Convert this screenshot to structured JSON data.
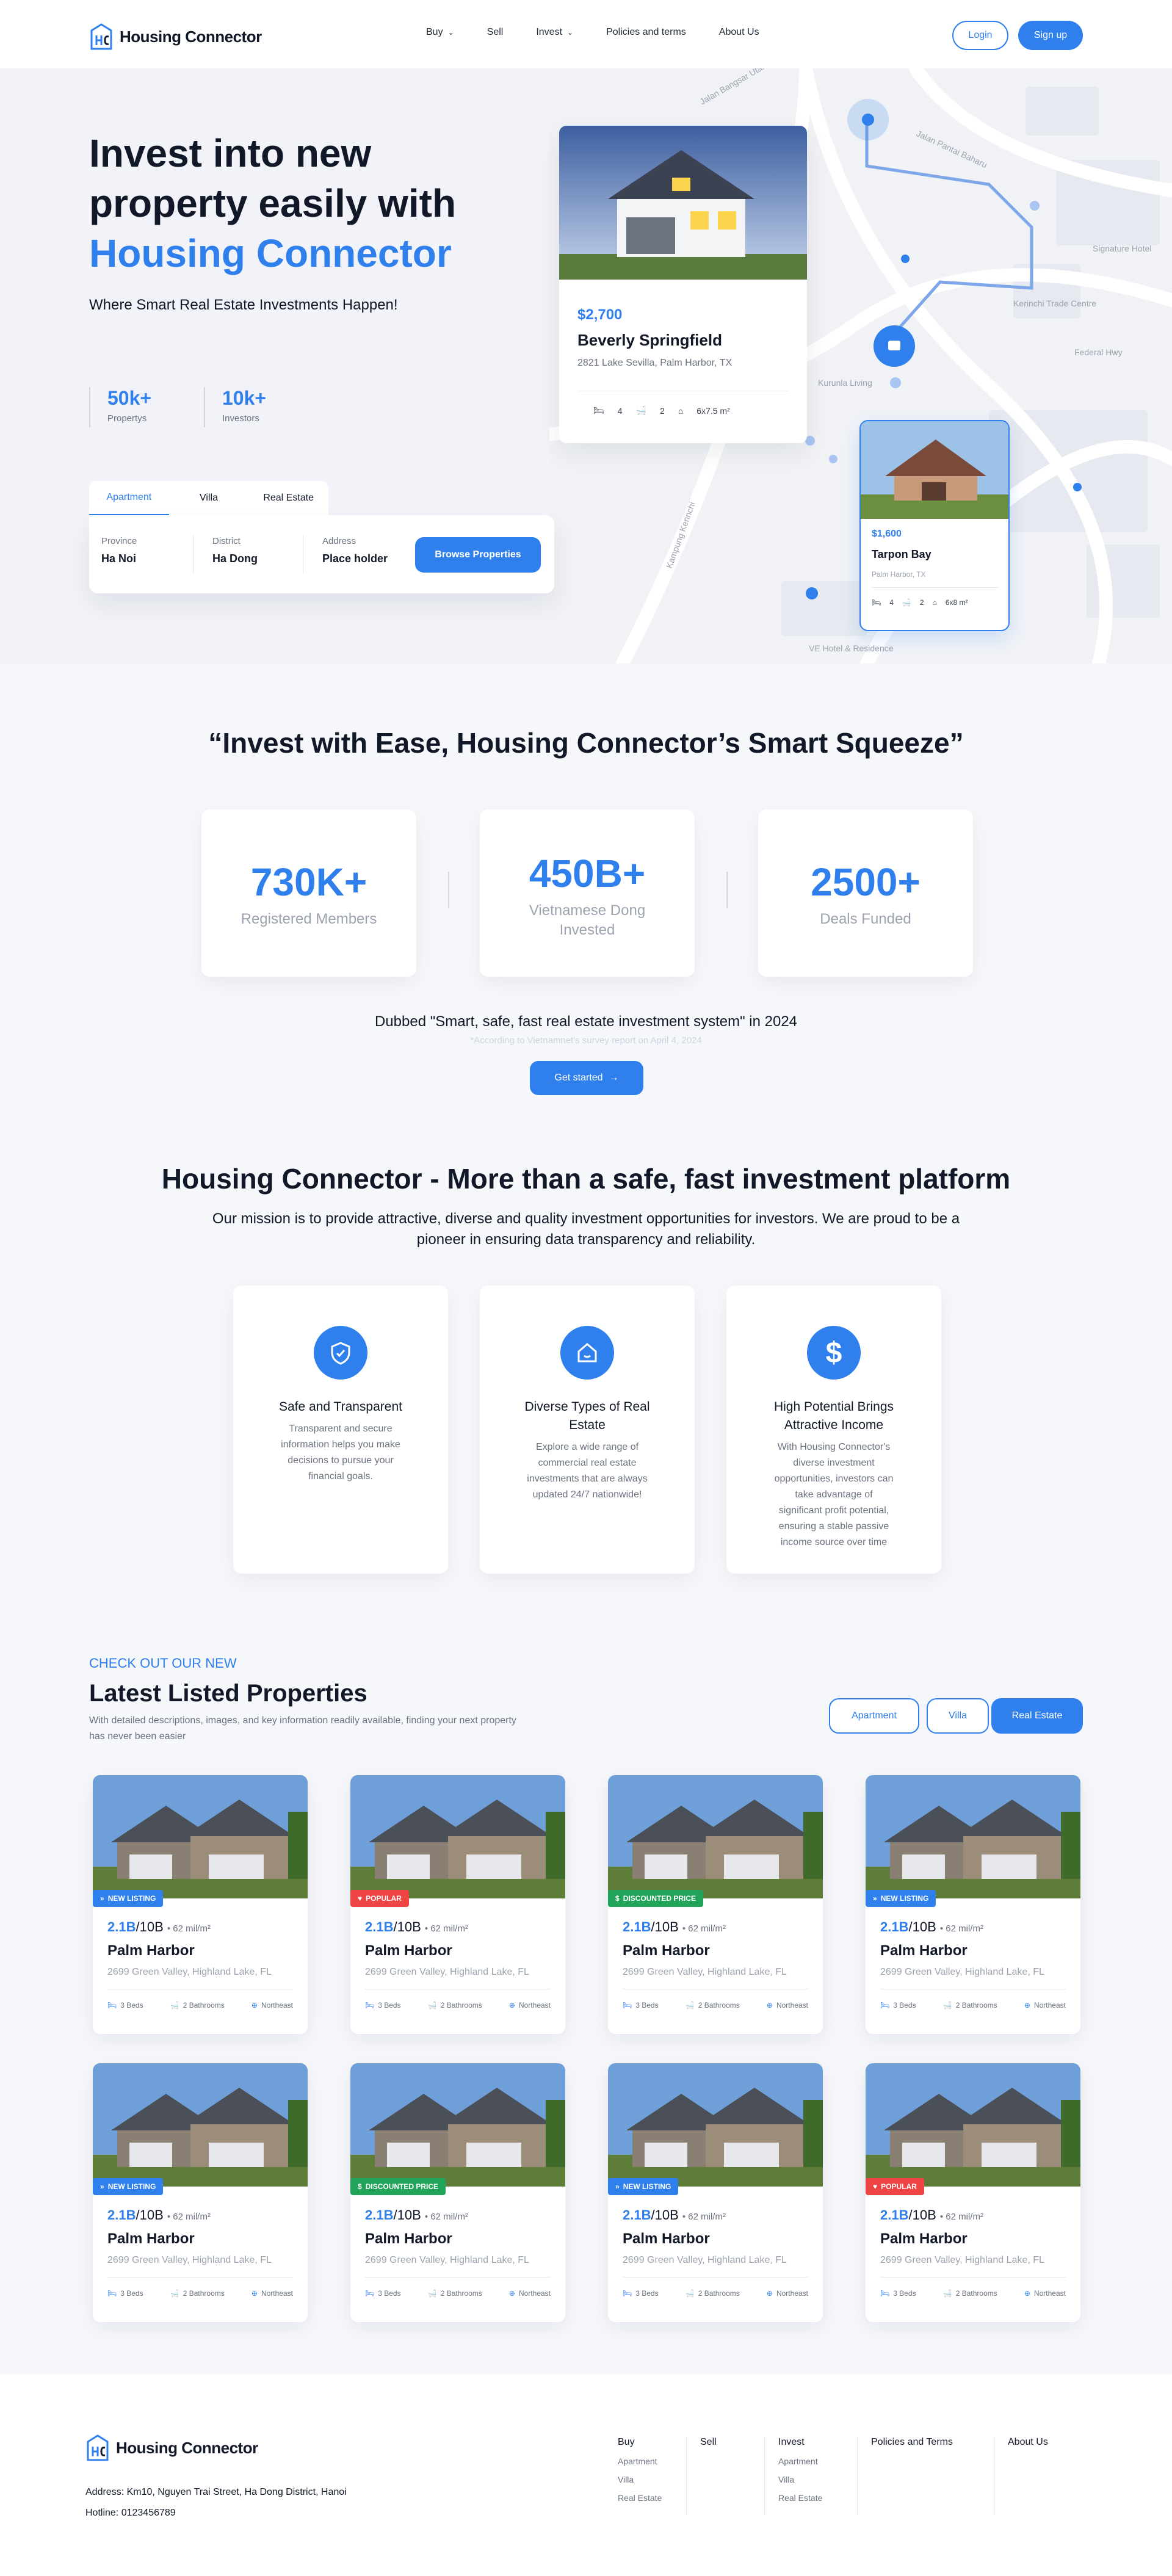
{
  "brand": {
    "name": "Housing Connector"
  },
  "nav": {
    "items": [
      "Buy",
      "Sell",
      "Invest",
      "Policies and terms",
      "About Us"
    ],
    "login": "Login",
    "signup": "Sign up"
  },
  "hero": {
    "title_line1": "Invest into new",
    "title_line2": "property easily with",
    "title_highlight": "Housing Connector",
    "subtitle": "Where Smart Real Estate Investments Happen!",
    "stats": [
      {
        "num": "50k+",
        "label": "Propertys"
      },
      {
        "num": "10k+",
        "label": "Investors"
      }
    ],
    "tabs": [
      "Apartment",
      "Villa",
      "Real Estate"
    ],
    "active_tab": "Apartment",
    "search": {
      "province_label": "Province",
      "province_value": "Ha Noi",
      "district_label": "District",
      "district_value": "Ha Dong",
      "address_label": "Address",
      "address_value": "Place holder",
      "button": "Browse Properties"
    },
    "featured": {
      "price": "$2,700",
      "name": "Beverly Springfield",
      "address": "2821 Lake Sevilla, Palm Harbor, TX",
      "beds": "4",
      "baths": "2",
      "area": "6x7.5 m²"
    },
    "small_card": {
      "price": "$1,600",
      "name": "Tarpon Bay",
      "address": "Palm Harbor, TX",
      "beds": "4",
      "baths": "2",
      "area": "6x8 m²"
    },
    "map_labels": [
      "Jalan Pantai Baharu",
      "Signature Hotel",
      "Federal Hwy",
      "Kurunla Living",
      "Kerinchi Trade Centre",
      "VE Hotel & Residence",
      "Jalan Bangsar Utama",
      "Kampung Kerinchi"
    ]
  },
  "stats_section": {
    "title": "“Invest with Ease, Housing Connector’s Smart Squeeze”",
    "items": [
      {
        "num": "730K+",
        "label": "Registered Members"
      },
      {
        "num": "450B+",
        "label": "Vietnamese Dong Invested"
      },
      {
        "num": "2500+",
        "label": "Deals Funded"
      }
    ],
    "dubbed": "Dubbed \"Smart, safe, fast real estate investment system\" in 2024",
    "note": "*According to Vietnamnet's survey report on April 4, 2024",
    "cta": "Get started"
  },
  "mission": {
    "title": "Housing Connector - More than a safe, fast investment platform",
    "desc": "Our mission is to provide attractive, diverse and quality investment opportunities for investors. We are proud to be a pioneer in ensuring data transparency and reliability.",
    "features": [
      {
        "icon": "shield-icon",
        "title": "Safe and Transparent",
        "desc": "Transparent and secure information helps you make decisions to pursue your financial goals."
      },
      {
        "icon": "home-icon",
        "title": "Diverse Types of Real Estate",
        "desc": "Explore a wide range of commercial real estate investments that are always updated 24/7 nationwide!"
      },
      {
        "icon": "dollar-icon",
        "title": "High Potential Brings Attractive Income",
        "desc": "With Housing Connector's diverse investment opportunities, investors can take advantage of significant profit potential, ensuring a stable passive income source over time"
      }
    ]
  },
  "listings": {
    "kicker": "CHECK OUT OUR NEW",
    "title": "Latest Listed Properties",
    "desc": "With detailed descriptions, images, and key information readily available, finding your next property has never been easier",
    "filters": [
      "Apartment",
      "Villa",
      "Real Estate"
    ],
    "active_filter": "Real Estate",
    "colors": {
      "new": "#2f80ed",
      "popular": "#ef4444",
      "discount": "#22a35a"
    },
    "cards": [
      {
        "badge": "NEW LISTING",
        "type": "new",
        "price": "2.1B",
        "total": "/10B",
        "area": "62 mil/m²",
        "name": "Palm Harbor",
        "address": "2699 Green Valley, Highland Lake, FL",
        "beds": "3 Beds",
        "baths": "2 Bathrooms",
        "dir": "Northeast"
      },
      {
        "badge": "POPULAR",
        "type": "popular",
        "price": "2.1B",
        "total": "/10B",
        "area": "62 mil/m²",
        "name": "Palm Harbor",
        "address": "2699 Green Valley, Highland Lake, FL",
        "beds": "3 Beds",
        "baths": "2 Bathrooms",
        "dir": "Northeast"
      },
      {
        "badge": "DISCOUNTED PRICE",
        "type": "discount",
        "price": "2.1B",
        "total": "/10B",
        "area": "62 mil/m²",
        "name": "Palm Harbor",
        "address": "2699 Green Valley, Highland Lake, FL",
        "beds": "3 Beds",
        "baths": "2 Bathrooms",
        "dir": "Northeast"
      },
      {
        "badge": "NEW LISTING",
        "type": "new",
        "price": "2.1B",
        "total": "/10B",
        "area": "62 mil/m²",
        "name": "Palm Harbor",
        "address": "2699 Green Valley, Highland Lake, FL",
        "beds": "3 Beds",
        "baths": "2 Bathrooms",
        "dir": "Northeast"
      },
      {
        "badge": "NEW LISTING",
        "type": "new",
        "price": "2.1B",
        "total": "/10B",
        "area": "62 mil/m²",
        "name": "Palm Harbor",
        "address": "2699 Green Valley, Highland Lake, FL",
        "beds": "3 Beds",
        "baths": "2 Bathrooms",
        "dir": "Northeast"
      },
      {
        "badge": "DISCOUNTED PRICE",
        "type": "discount",
        "price": "2.1B",
        "total": "/10B",
        "area": "62 mil/m²",
        "name": "Palm Harbor",
        "address": "2699 Green Valley, Highland Lake, FL",
        "beds": "3 Beds",
        "baths": "2 Bathrooms",
        "dir": "Northeast"
      },
      {
        "badge": "NEW LISTING",
        "type": "new",
        "price": "2.1B",
        "total": "/10B",
        "area": "62 mil/m²",
        "name": "Palm Harbor",
        "address": "2699 Green Valley, Highland Lake, FL",
        "beds": "3 Beds",
        "baths": "2 Bathrooms",
        "dir": "Northeast"
      },
      {
        "badge": "POPULAR",
        "type": "popular",
        "price": "2.1B",
        "total": "/10B",
        "area": "62 mil/m²",
        "name": "Palm Harbor",
        "address": "2699 Green Valley, Highland Lake, FL",
        "beds": "3 Beds",
        "baths": "2 Bathrooms",
        "dir": "Northeast"
      }
    ]
  },
  "footer": {
    "address": "Address: Km10, Nguyen Trai Street, Ha Dong District, Hanoi",
    "hotline": "Hotline: 0123456789",
    "columns": [
      {
        "title": "Buy",
        "items": [
          "Apartment",
          "Villa",
          "Real Estate"
        ]
      },
      {
        "title": "Sell",
        "items": []
      },
      {
        "title": "Invest",
        "items": [
          "Apartment",
          "Villa",
          "Real Estate"
        ]
      },
      {
        "title": "Policies and Terms",
        "items": []
      },
      {
        "title": "About Us",
        "items": []
      }
    ]
  }
}
